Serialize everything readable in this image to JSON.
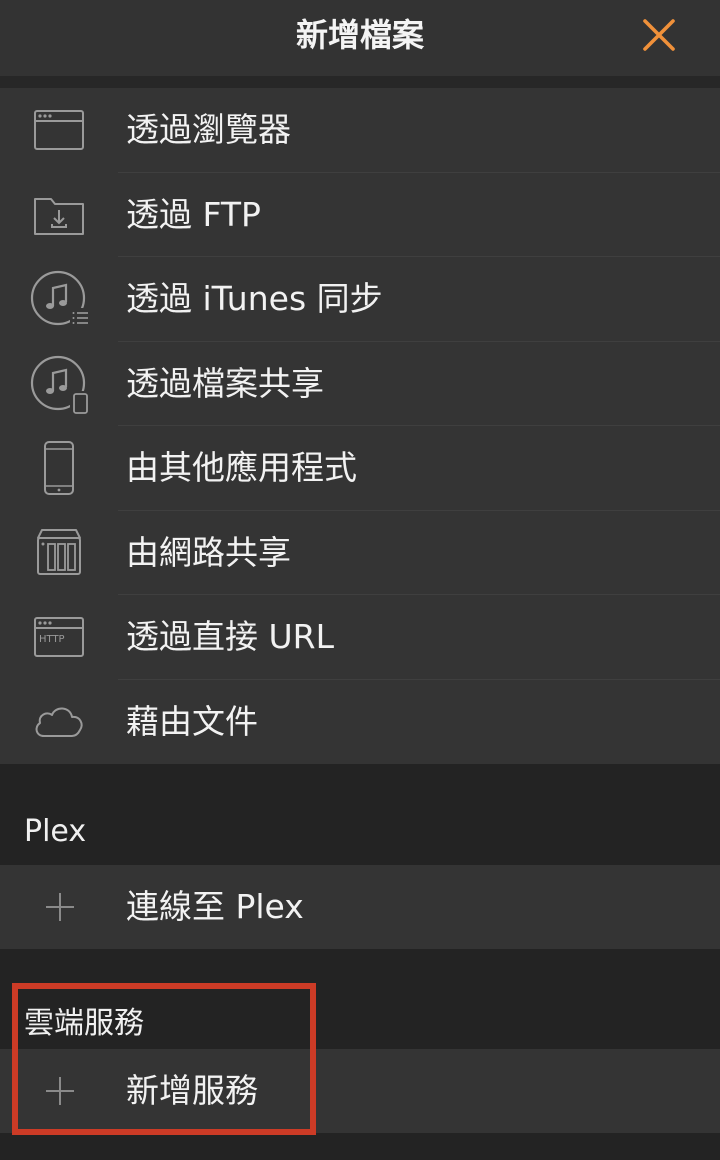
{
  "header": {
    "title": "新增檔案",
    "close_icon": "close-icon",
    "accent_color": "#f0913a"
  },
  "menu": {
    "items": [
      {
        "label": "透過瀏覽器",
        "icon": "browser-window-icon"
      },
      {
        "label": "透過 FTP",
        "icon": "folder-download-icon"
      },
      {
        "label": "透過 iTunes 同步",
        "icon": "itunes-sync-icon"
      },
      {
        "label": "透過檔案共享",
        "icon": "itunes-file-sharing-icon"
      },
      {
        "label": "由其他應用程式",
        "icon": "phone-icon"
      },
      {
        "label": "由網路共享",
        "icon": "nas-icon"
      },
      {
        "label": "透過直接 URL",
        "icon": "http-window-icon"
      },
      {
        "label": "藉由文件",
        "icon": "cloud-icon"
      }
    ]
  },
  "plex": {
    "header": "Plex",
    "connect_label": "連線至 Plex",
    "icon": "plus-icon"
  },
  "cloud": {
    "header": "雲端服務",
    "add_label": "新增服務",
    "icon": "plus-icon",
    "highlight_color": "#cc3b26"
  }
}
